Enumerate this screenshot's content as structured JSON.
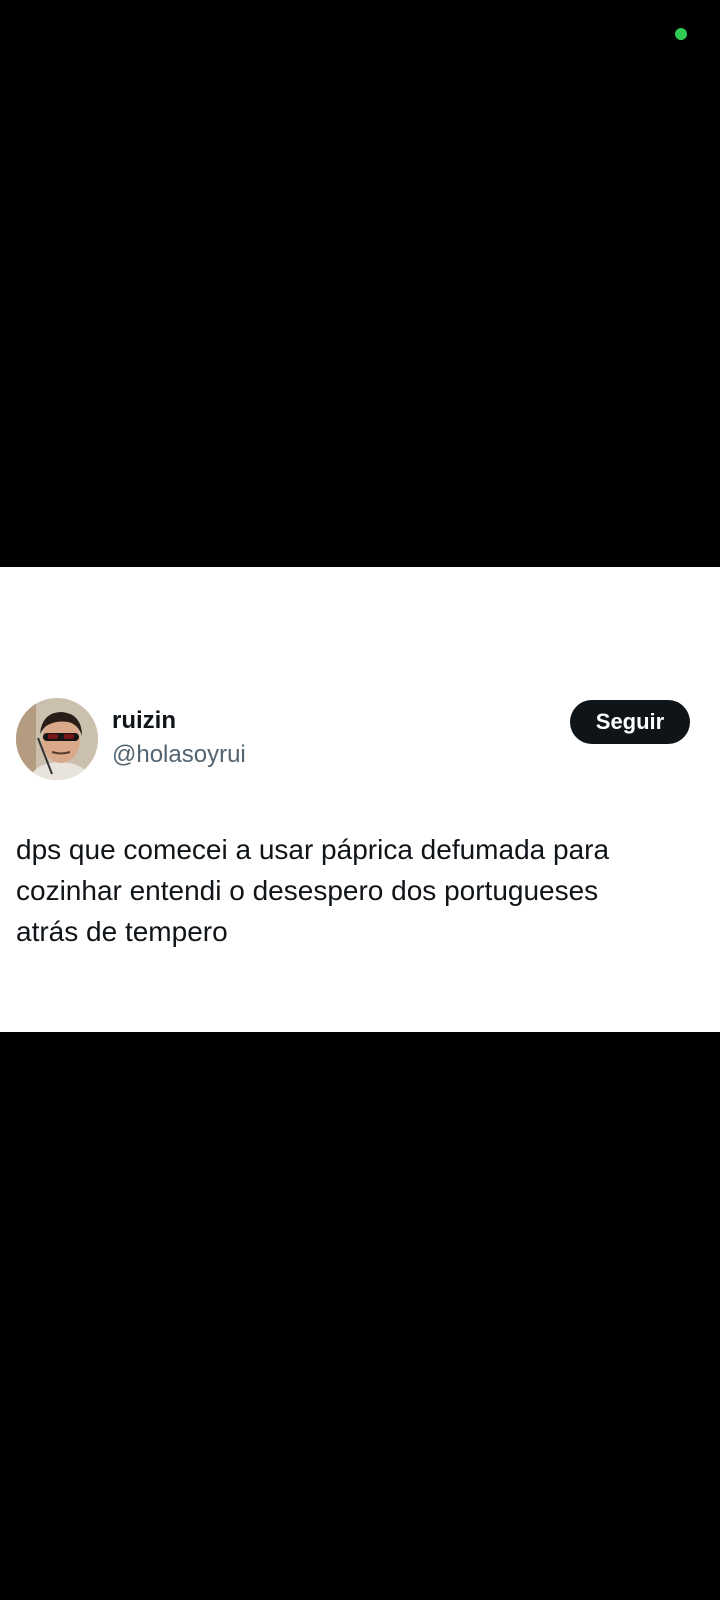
{
  "status_bar": {
    "indicator_color": "#2ecc52"
  },
  "tweet": {
    "author": {
      "display_name": "ruizin",
      "handle": "@holasoyrui"
    },
    "follow_label": "Seguir",
    "text_lines": [
      "dps que comecei a usar páprica defumada para",
      "cozinhar entendi o desespero dos portugueses",
      "atrás de tempero"
    ]
  },
  "colors": {
    "background": "#000000",
    "card": "#ffffff",
    "text_primary": "#0f1419",
    "text_secondary": "#536471",
    "button": "#0f1419"
  }
}
